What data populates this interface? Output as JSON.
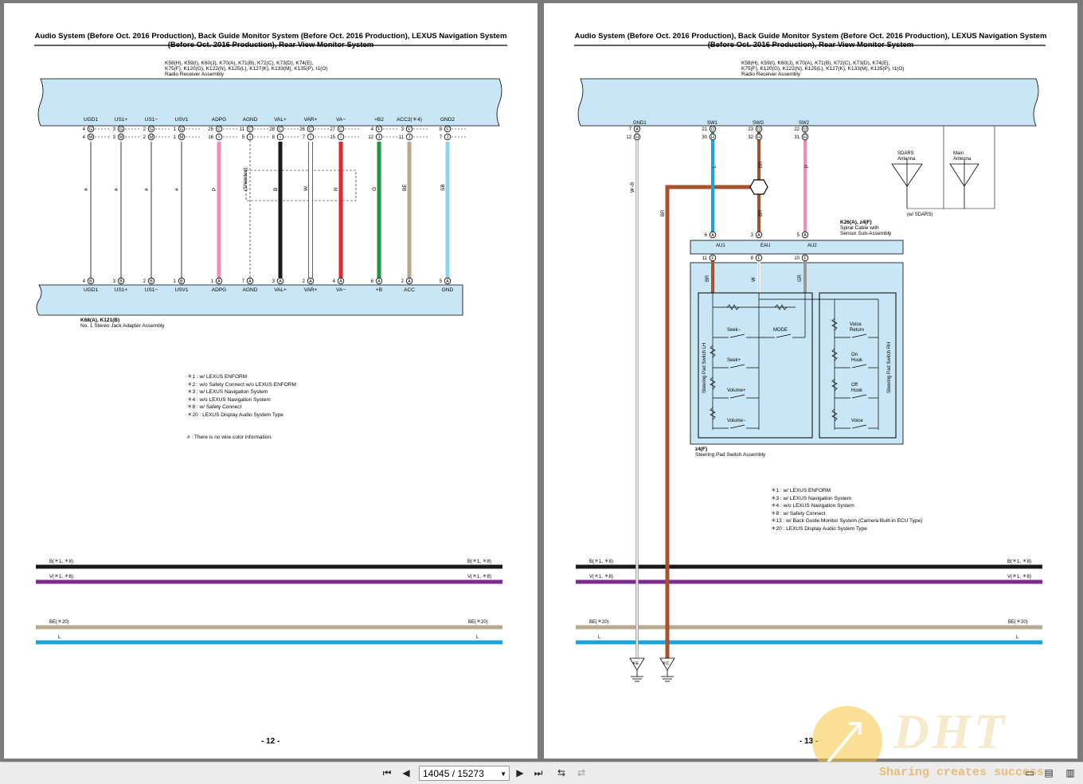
{
  "pages": [
    {
      "title_line1": "Audio System (Before Oct. 2016 Production), Back Guide Monitor System (Before Oct. 2016 Production), LEXUS Navigation System",
      "title_line2": "(Before Oct. 2016 Production), Rear View Monitor System",
      "connector_ids": "K58(H), K59(I), K60(J), K70(A), K71(B), K72(C), K73(D), K74(E),",
      "connector_ids2": "K75(F), K120(G), K122(N), K125(L), K127(K), K133(M), K135(P), I1(O)",
      "connector_name": "Radio Receiver Assembly",
      "lower_connector_ids": "K68(A), K121(B)",
      "lower_connector_name": "No. 1 Stereo Jack Adapter Assembly",
      "page_number": "- 12 -",
      "notes": [
        "＊1 : w/ LEXUS ENFORM",
        "＊2 : w/o Safety Connect w/o LEXUS ENFORM",
        "＊3 : w/ LEXUS Navigation System",
        "＊4 : w/o LEXUS Navigation System",
        "＊8 : w/ Safety Connect",
        "＊20 : LEXUS Display Audio System Type"
      ],
      "footnote": "# : There is no wire color information."
    },
    {
      "title_line1": "Audio System (Before Oct. 2016 Production), Back Guide Monitor System (Before Oct. 2016 Production), LEXUS Navigation System",
      "title_line2": "(Before Oct. 2016 Production), Rear View Monitor System",
      "connector_ids": "K58(H), K59(I), K60(J), K70(A), K71(B), K72(C), K73(D), K74(E),",
      "connector_ids2": "K75(F), K120(G), K122(N), K125(L), K127(K), K133(M), K135(P), I1(O)",
      "connector_name": "Radio Receiver Assembly",
      "spiral_ids": "K26(A), z4(F)",
      "spiral_name1": "Spiral Cable with",
      "spiral_name2": "Sensor Sub-Assembly",
      "steering_id": "z4(F)",
      "steering_name": "Steering Pad Switch Assembly",
      "page_number": "- 13 -",
      "notes": [
        "＊1 : w/ LEXUS ENFORM",
        "＊3 : w/ LEXUS Navigation System",
        "＊4 : w/o LEXUS Navigation System",
        "＊8 : w/ Safety Connect",
        "＊13 : w/ Back Guide Monitor System (Camera Built-in ECU Type)",
        "＊20 : LEXUS Display Audio System Type"
      ]
    }
  ],
  "toolbar": {
    "page_indicator": "14045 / 15273"
  },
  "watermark": {
    "logo": "DHT",
    "tagline": "Sharing creates success"
  },
  "colors": {
    "wire_pink": "#ef8cb8",
    "wire_red": "#e2262a",
    "wire_green": "#1a9a3c",
    "wire_beige": "#b9a98e",
    "wire_skyblue": "#8fd6ee",
    "wire_blue": "#1aa3dc",
    "wire_brown": "#a6522c",
    "wire_gray": "#9a9a9a",
    "wire_violet": "#7b2d8c",
    "connector_fill": "#c8e6f5"
  }
}
